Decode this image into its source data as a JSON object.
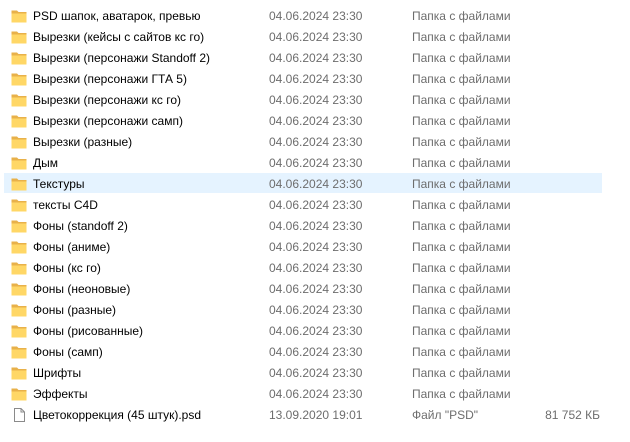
{
  "colors": {
    "folder_body": "#FFD766",
    "folder_back": "#E8B14A",
    "hover_row": "#E5F3FF",
    "meta_text": "#6D6D6D"
  },
  "files": [
    {
      "name": "PSD шапок, аватарок, превью",
      "date": "04.06.2024 23:30",
      "type": "Папка с файлами",
      "size": "",
      "icon": "folder-icon"
    },
    {
      "name": "Вырезки (кейсы с сайтов кс го)",
      "date": "04.06.2024 23:30",
      "type": "Папка с файлами",
      "size": "",
      "icon": "folder-icon"
    },
    {
      "name": "Вырезки (персонажи Standoff 2)",
      "date": "04.06.2024 23:30",
      "type": "Папка с файлами",
      "size": "",
      "icon": "folder-icon"
    },
    {
      "name": "Вырезки (персонажи ГТА 5)",
      "date": "04.06.2024 23:30",
      "type": "Папка с файлами",
      "size": "",
      "icon": "folder-icon"
    },
    {
      "name": "Вырезки (персонажи кс го)",
      "date": "04.06.2024 23:30",
      "type": "Папка с файлами",
      "size": "",
      "icon": "folder-icon"
    },
    {
      "name": "Вырезки (персонажи самп)",
      "date": "04.06.2024 23:30",
      "type": "Папка с файлами",
      "size": "",
      "icon": "folder-icon"
    },
    {
      "name": "Вырезки (разные)",
      "date": "04.06.2024 23:30",
      "type": "Папка с файлами",
      "size": "",
      "icon": "folder-icon"
    },
    {
      "name": "Дым",
      "date": "04.06.2024 23:30",
      "type": "Папка с файлами",
      "size": "",
      "icon": "folder-icon"
    },
    {
      "name": "Текстуры",
      "date": "04.06.2024 23:30",
      "type": "Папка с файлами",
      "size": "",
      "icon": "folder-icon",
      "hover": true
    },
    {
      "name": "тексты C4D",
      "date": "04.06.2024 23:30",
      "type": "Папка с файлами",
      "size": "",
      "icon": "folder-icon"
    },
    {
      "name": "Фоны (standoff 2)",
      "date": "04.06.2024 23:30",
      "type": "Папка с файлами",
      "size": "",
      "icon": "folder-icon"
    },
    {
      "name": "Фоны (аниме)",
      "date": "04.06.2024 23:30",
      "type": "Папка с файлами",
      "size": "",
      "icon": "folder-icon"
    },
    {
      "name": "Фоны (кс го)",
      "date": "04.06.2024 23:30",
      "type": "Папка с файлами",
      "size": "",
      "icon": "folder-icon"
    },
    {
      "name": "Фоны (неоновые)",
      "date": "04.06.2024 23:30",
      "type": "Папка с файлами",
      "size": "",
      "icon": "folder-icon"
    },
    {
      "name": "Фоны (разные)",
      "date": "04.06.2024 23:30",
      "type": "Папка с файлами",
      "size": "",
      "icon": "folder-icon"
    },
    {
      "name": "Фоны (рисованные)",
      "date": "04.06.2024 23:30",
      "type": "Папка с файлами",
      "size": "",
      "icon": "folder-icon"
    },
    {
      "name": "Фоны (самп)",
      "date": "04.06.2024 23:30",
      "type": "Папка с файлами",
      "size": "",
      "icon": "folder-icon"
    },
    {
      "name": "Шрифты",
      "date": "04.06.2024 23:30",
      "type": "Папка с файлами",
      "size": "",
      "icon": "folder-icon"
    },
    {
      "name": "Эффекты",
      "date": "04.06.2024 23:30",
      "type": "Папка с файлами",
      "size": "",
      "icon": "folder-icon"
    },
    {
      "name": "Цветокоррекция (45 штук).psd",
      "date": "13.09.2020 19:01",
      "type": "Файл \"PSD\"",
      "size": "81 752 КБ",
      "icon": "psd-file-icon"
    }
  ]
}
